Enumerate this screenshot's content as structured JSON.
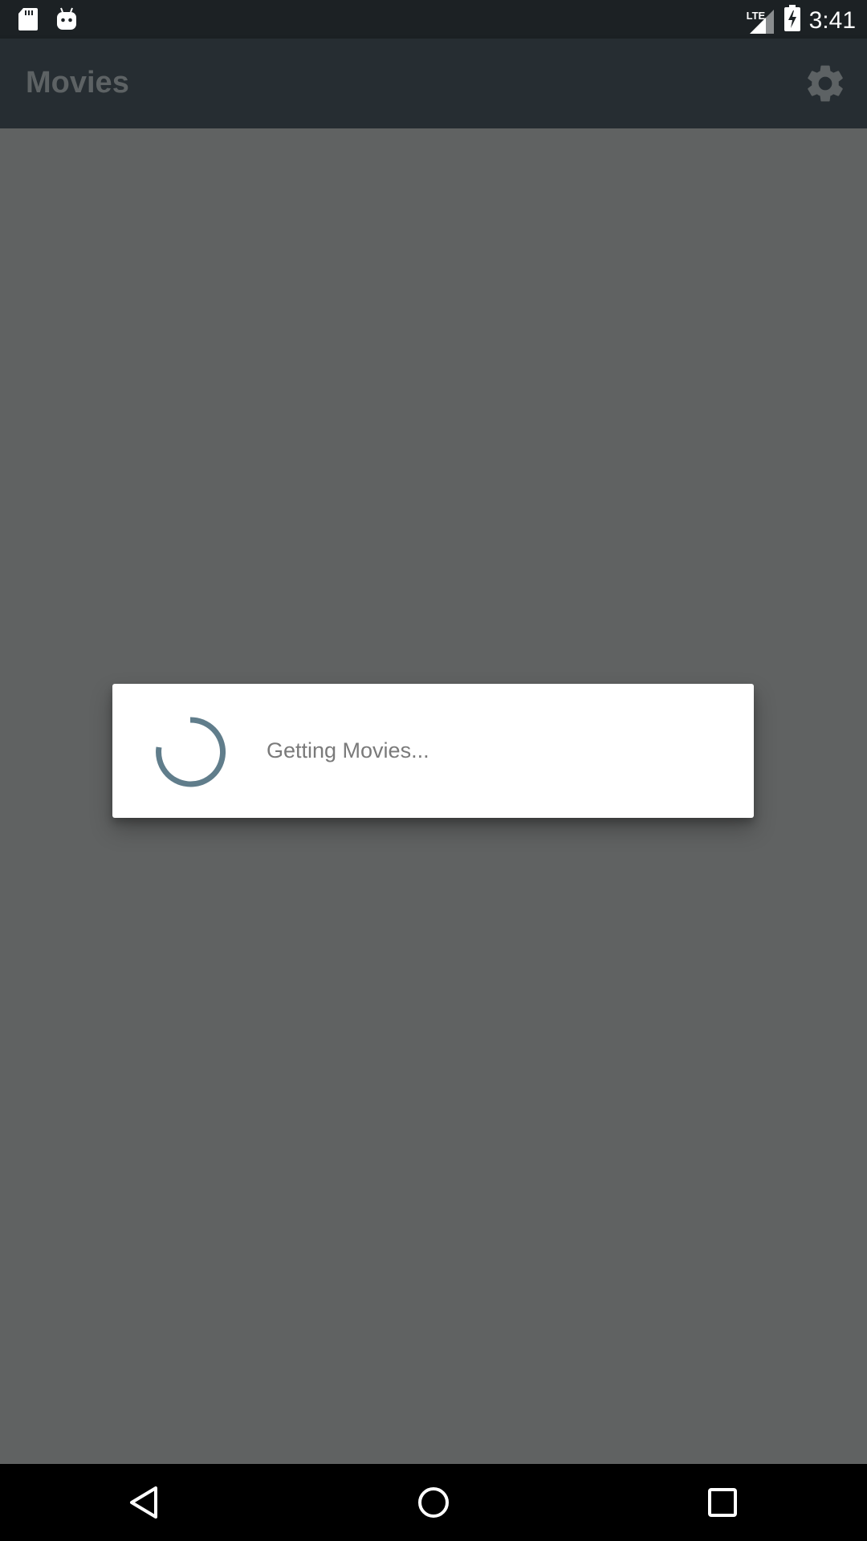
{
  "status_bar": {
    "time": "3:41",
    "network": "LTE",
    "icons": [
      "sd-card-icon",
      "android-debug-icon",
      "signal-icon",
      "battery-charging-icon"
    ]
  },
  "app_bar": {
    "title": "Movies",
    "actions": [
      "settings-gear-icon"
    ]
  },
  "progress_dialog": {
    "message": "Getting Movies..."
  },
  "nav_bar": {
    "buttons": [
      "back-icon",
      "home-icon",
      "recents-icon"
    ]
  },
  "colors": {
    "scrim": "#606262",
    "app_bar": "#262d32",
    "status_bar": "#1c2124",
    "spinner": "#607d8b",
    "dialog_text": "#7a7a7a"
  }
}
